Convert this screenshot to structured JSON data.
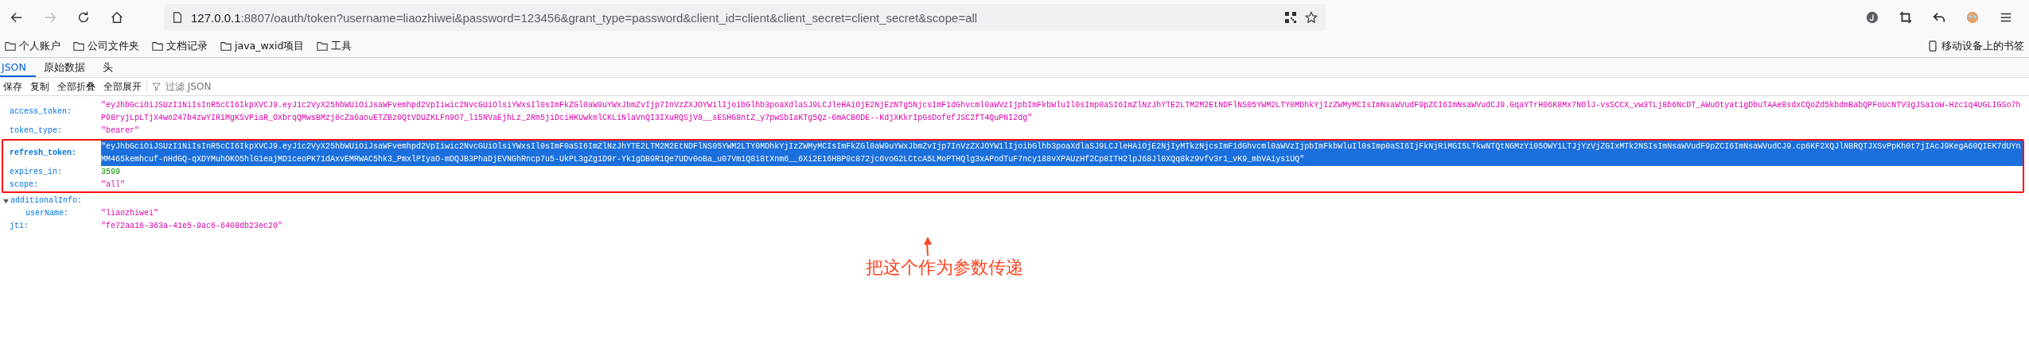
{
  "browser": {
    "nav": [
      {
        "kind": "back",
        "disabled": false
      },
      {
        "kind": "forward",
        "disabled": true
      },
      {
        "kind": "reload",
        "disabled": false
      },
      {
        "kind": "home",
        "disabled": false
      }
    ],
    "url": {
      "host": "127.0.0.1",
      "rest": ":8807/oauth/token?username=liaozhiwei&password=123456&grant_type=password&client_id=client&client_secret=client_secret&scope=all"
    },
    "bookmarks": [
      "个人账户",
      "公司文件夹",
      "文档记录",
      "java_wxid项目",
      "工具"
    ],
    "mobile_bookmarks": "移动设备上的书签"
  },
  "viewer": {
    "tabs": [
      {
        "label": "JSON",
        "selected": true
      },
      {
        "label": "原始数据",
        "selected": false
      },
      {
        "label": "头",
        "selected": false
      }
    ],
    "toolbar": [
      "保存",
      "复制",
      "全部折叠",
      "全部展开"
    ],
    "filter": {
      "placeholder": "过滤 JSON"
    }
  },
  "rows": [
    {
      "key": "access_token:",
      "kind": "string",
      "value": "\"eyJhbGciOiJSUzI1NiIsInR5cCI6IkpXVCJ9.eyJ1c2VyX25hbWUiOiJsaWFvemhpd2VpIiwic2NvcGUiOlsiYWxsIl0sImFkZGl0aW9uYWxJbmZvIjp7InVzZXJOYW1lIjoibGlhb3poaXdlaSJ9LCJleHAiOjE2NjEzNTg5NjcsImF1dGhvcml0aWVzIjpbImFkbWluIl0sImp0aSI6ImZlNzJhYTE2LTM2M2EtNDFlNS05YWM2LTY0MDhkYjIzZWMyMCIsImNsaWVudF9pZCI6ImNsaWVudCJ9.GqaYTrH06K8Mx7NOlJ-vsSCCX_vw3TLj8b6NcDT_AWuOtyatigDbuTAAe8sdxCQoZd5kbdmBabQPFoUcNTV3gJSa1oW-Hzc1q4UGLIGSo7hP08ryjLpLTjX4wo247b4zwYIRiMgKSvPiaR_OXbrqQMwsBMzj6cZa6aouETZBz0QtVDUZKLFn9O7_l15NVaEjhLz_2Rm5jiDciHKUwkmlCKLiNlaVnQI3IXuRQSjV8__sESHG8ntZ_y7pwSbIaKTg5Qz-6mACBODE--KdjXKkrIpGsDofefJSC2fT4QuPNI2dg\"",
      "selected": false,
      "boxed": false
    },
    {
      "key": "token_type:",
      "kind": "string",
      "value": "\"bearer\"",
      "selected": false,
      "boxed": false
    },
    {
      "key": "refresh_token:",
      "kind": "string",
      "value": "\"eyJhbGciOiJSUzI1NiIsInR5cCI6IkpXVCJ9.eyJ1c2VyX25hbWUiOiJsaWFvemhpd2VpIiwic2NvcGUiOlsiYWxsIl0sImF0aSI6ImZlNzJhYTE2LTM2M2EtNDFlNS05YWM2LTY0MDhkYjIzZWMyMCIsImFkZGl0aW9uYWxJbmZvIjp7InVzZXJOYW1lIjoibGlhb3poaXdlaSJ9LCJleHAiOjE2NjIyMTkzNjcsImF1dGhvcml0aWVzIjpbImFkbWluIl0sImp0aSI6IjFkNjRiMGI5LTkwNTQtNGMzYi05OWY1LTJjYzVjZGIxMTk2NSIsImNsaWVudF9pZCI6ImNsaWVudCJ9.cp6KF2XQJlNBRQTJXSvPpKh0t7jIAcJ9KegA60QIEK7dUYnMM465kemhcuf-nHdGQ-qXDYMuhOKO5hlG1eajMD1ceoPK71dAxvEMRWAC5hk3_PmxlPIyaO-mDQJB3PhaDjEVNGhRncp7u5-UkPL3gZg1D9r-Yk1gDB9R1Qe7UDv0oBa_u07Vm1Q8i8tXnm6__6Xi2E16HBP0c872jc6voG2LCtcA5LMoPTHQlg3xAPodTuF7ncy188vXPAUzHf2Cp8ITH2lpJ68Jl0XQq8kz9vfv3r1_vK9_mbVAiys1UQ\"",
      "selected": true,
      "boxed": true
    },
    {
      "key": "expires_in:",
      "kind": "number",
      "value": "3599",
      "selected": false,
      "boxed": true
    },
    {
      "key": "scope:",
      "kind": "string",
      "value": "\"all\"",
      "selected": false,
      "boxed": true
    },
    {
      "key": "additionalInfo:",
      "kind": "object",
      "expanded": true,
      "selected": false,
      "boxed": false,
      "children": [
        {
          "key": "userName:",
          "kind": "string",
          "value": "\"liaozhiwei\""
        }
      ]
    },
    {
      "key": "jti:",
      "kind": "string",
      "value": "\"fe72aa16-363a-41e5-9ac6-6408db23ec20\"",
      "selected": false,
      "boxed": false
    }
  ],
  "annotation": "把这个作为参数传递"
}
